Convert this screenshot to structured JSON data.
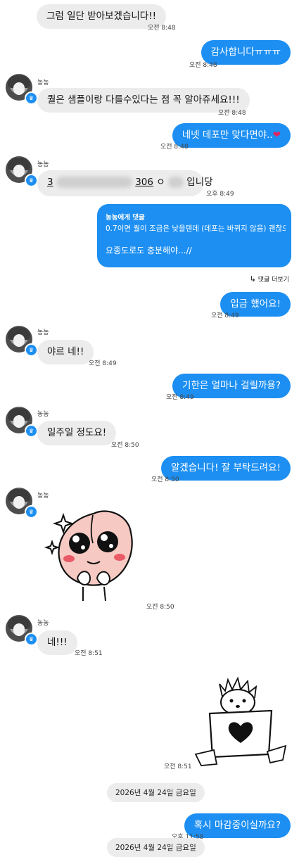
{
  "avatar_badge": "♛",
  "messages": {
    "m1": {
      "text": "그럼 일단 받아보겠습니다!!",
      "time": "오전 8:48"
    },
    "m2": {
      "text": "감사합니다ㅠㅠㅠ",
      "time": "오전 8:48"
    },
    "m3": {
      "nick": "농농",
      "text": "퀄은 샘플이랑 다를수있다는 점 꼭 알아쥬세요!!!",
      "time": "오전 8:48"
    },
    "m4": {
      "text": "네넷 데포만 맞다면야..",
      "heart": "❤",
      "time": "오전 8:48"
    },
    "m5": {
      "nick": "농농",
      "text_a": "3",
      "text_b": "306",
      "text_c": "ㅇ",
      "text_d": "입니당",
      "time": "오후 8:49"
    },
    "m6": {
      "reply_to": "농농에게 댓글",
      "quote": "0.7이면 퀄이 조금은 낮을텐데 (데포는 바뀌지 않음) 괜찮으...",
      "text": "요종도로도 충분해야...//"
    },
    "m6b": {
      "icon": "↳",
      "more_replies": "댓글 더보기"
    },
    "m7": {
      "text": "입금 했어요!",
      "time": "오전 8:49"
    },
    "m8": {
      "nick": "농농",
      "text": "야르 네!!",
      "time": "오전 8:49"
    },
    "m9": {
      "text": "기한은 얼마나 걸릴까용?",
      "time": "오전 8:49"
    },
    "m10": {
      "nick": "농농",
      "text": "일주일 정도요!",
      "time": "오전 8:50"
    },
    "m11": {
      "text": "알겠습니다! 잘 부탁드려요!",
      "time": "오전 8:50"
    },
    "m12": {
      "nick": "농농",
      "time": "오전 8:50"
    },
    "m13": {
      "nick": "농농",
      "text": "네!!!",
      "time": "오전 8:51"
    },
    "m14": {
      "time": "오전 8:51"
    },
    "date_divider": "2026년 4월 24일 금요일",
    "m15": {
      "text": "혹시 마감중이실까요?",
      "time": "오후 11:58"
    },
    "bottom_divider": "2026년 4월 24일 금요일"
  }
}
